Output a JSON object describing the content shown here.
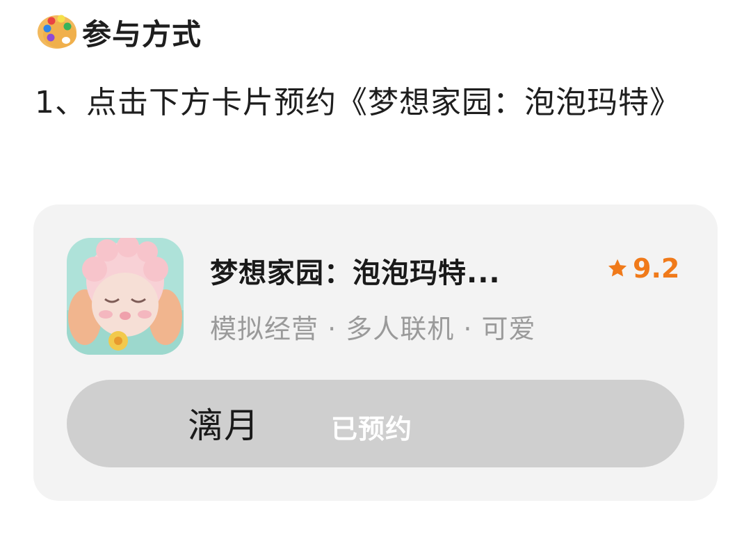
{
  "section": {
    "icon": "palette-icon",
    "title": "参与方式"
  },
  "step1": {
    "text": "1、点击下方卡片预约《梦想家园：泡泡玛特》"
  },
  "card": {
    "icon": "game-app-icon",
    "title": "梦想家园：泡泡玛特...",
    "rating_icon": "star-icon",
    "rating": "9.2",
    "tags": "模拟经营 · 多人联机 · 可爱",
    "button_left_text": "漓月",
    "button_status": "已预约",
    "accent_color": "#f07a1a",
    "card_bg": "#f3f3f3",
    "button_bg": "#cfcfcf"
  },
  "cut_off_line": {
    "text": ""
  }
}
